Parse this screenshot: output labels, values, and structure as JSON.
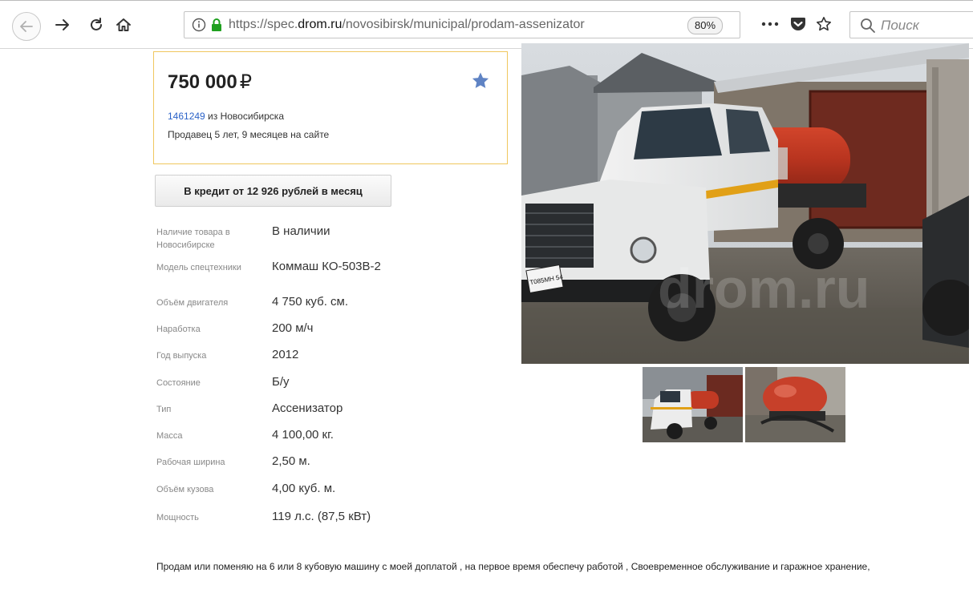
{
  "browser": {
    "url_prefix": "https://spec.",
    "url_domain": "drom.ru",
    "url_path": "/novosibirsk/municipal/prodam-assenizator",
    "zoom": "80%",
    "search_placeholder": "Поиск"
  },
  "listing": {
    "price": "750 000",
    "currency": "₽",
    "ad_number": "1461249",
    "ad_city": " из Новосибирска",
    "seller_info": "Продавец 5 лет, 9 месяцев на сайте",
    "credit_button": "В кредит от 12 926 рублей в месяц"
  },
  "specs": [
    {
      "label": "Наличие товара в Новосибирске",
      "value": "В наличии"
    },
    {
      "label": "Модель спецтехники",
      "value": "Коммаш КО-503В-2"
    },
    {
      "label": "Объём двигателя",
      "value": "4 750 куб. см."
    },
    {
      "label": "Наработка",
      "value": "200 м/ч"
    },
    {
      "label": "Год выпуска",
      "value": "2012"
    },
    {
      "label": "Состояние",
      "value": "Б/у"
    },
    {
      "label": "Тип",
      "value": "Ассенизатор"
    },
    {
      "label": "Масса",
      "value": "4 100,00 кг."
    },
    {
      "label": "Рабочая ширина",
      "value": "2,50 м."
    },
    {
      "label": "Объём кузова",
      "value": "4,00 куб. м."
    },
    {
      "label": "Мощность",
      "value": "119 л.с. (87,5 кВт)"
    }
  ],
  "photo": {
    "watermark": "drom.ru",
    "plate": "Т085МН 54"
  },
  "description": "Продам или поменяю на 6 или 8 кубовую машину с моей доплатой , на первое время обеспечу работой , Своевременное обслуживание и гаражное хранение,",
  "colors": {
    "accent_border": "#f0c75e",
    "link": "#2b62c8",
    "star": "#5f83c4"
  }
}
